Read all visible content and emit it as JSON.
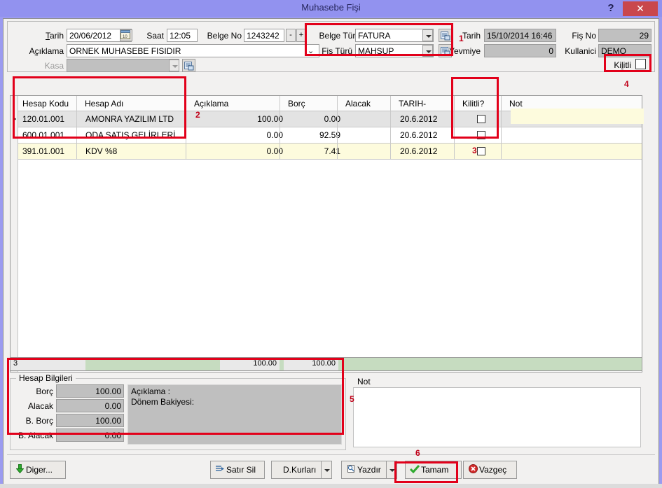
{
  "window": {
    "title": "Muhasebe Fişi",
    "help_label": "?",
    "close_label": "✕"
  },
  "header": {
    "tarih_label": "Tarih",
    "tarih_value": "20/06/2012",
    "saat_label": "Saat",
    "saat_value": "12:05",
    "belge_no_label": "Belge No",
    "belge_no_value": "1243242",
    "spin_minus": "-",
    "spin_plus": "+",
    "aciklama_label": "Açıklama",
    "aciklama_value": "ORNEK MUHASEBE FISIDIR",
    "kasa_label": "Kasa",
    "kasa_value": "",
    "belge_turu_label": "Belge Türü",
    "belge_turu_value": "FATURA",
    "fis_turu_label": "Fis Türü",
    "fis_turu_value": "MAHSUP",
    "tarih2_label": "Tarih",
    "tarih2_value": "15/10/2014 16:46",
    "yevmiye_label": "Yevmiye",
    "yevmiye_value": "0",
    "fis_no_label": "Fiş No",
    "fis_no_value": "29",
    "kullanici_label": "Kullanici",
    "kullanici_value": "DEMO",
    "kilitli_label": "Kilitli",
    "kilitli_checked": false
  },
  "grid": {
    "columns": [
      "Hesap Kodu",
      "Hesap Adı",
      "Açıklama",
      "Borç",
      "Alacak",
      "TARIH-",
      "Kilitli?",
      "Not"
    ],
    "rows": [
      {
        "hesap_kodu": "120.01.001",
        "hesap_adi": "AMONRA YAZILIM LTD",
        "aciklama": "",
        "borc": "100.00",
        "alacak": "0.00",
        "tarih": "20.6.2012",
        "kilitli": false,
        "not": ""
      },
      {
        "hesap_kodu": "600.01.001",
        "hesap_adi": "ODA SATIŞ GELİRLERİ",
        "aciklama": "",
        "borc": "0.00",
        "alacak": "92.59",
        "tarih": "20.6.2012",
        "kilitli": false,
        "not": ""
      },
      {
        "hesap_kodu": "391.01.001",
        "hesap_adi": "KDV %8",
        "aciklama": "",
        "borc": "0.00",
        "alacak": "7.41",
        "tarih": "20.6.2012",
        "kilitli": false,
        "not": ""
      }
    ],
    "footer": {
      "count": "3",
      "borc_total": "100.00",
      "alacak_total": "100.00"
    }
  },
  "hesap_bilgileri": {
    "title": "Hesap Bilgileri",
    "borc_label": "Borç",
    "borc_value": "100.00",
    "alacak_label": "Alacak",
    "alacak_value": "0.00",
    "b_borc_label": "B. Borç",
    "b_borc_value": "100.00",
    "b_alacak_label": "B. Alacak",
    "b_alacak_value": "0.00",
    "aciklama_line": "Açıklama :",
    "donem_line": "Dönem Bakiyesi:"
  },
  "not_panel": {
    "title": "Not",
    "value": ""
  },
  "toolbar": {
    "diger_label": "Diger...",
    "satir_sil_label": "Satır Sil",
    "dkurlari_label": "D.Kurları",
    "yazdir_label": "Yazdır",
    "tamam_label": "Tamam",
    "vazgec_label": "Vazgeç"
  },
  "annotations": {
    "n1": "1",
    "n2": "2",
    "n3": "3",
    "n4": "4",
    "n5": "5",
    "n6": "6"
  },
  "colors": {
    "titlebar": "#9292ef",
    "close": "#c9474c",
    "annotation_red": "#e2001a",
    "row_selected": "#e3e3e3",
    "row_yellow": "#fdfbdd",
    "footer_green": "#c6dcc0"
  }
}
